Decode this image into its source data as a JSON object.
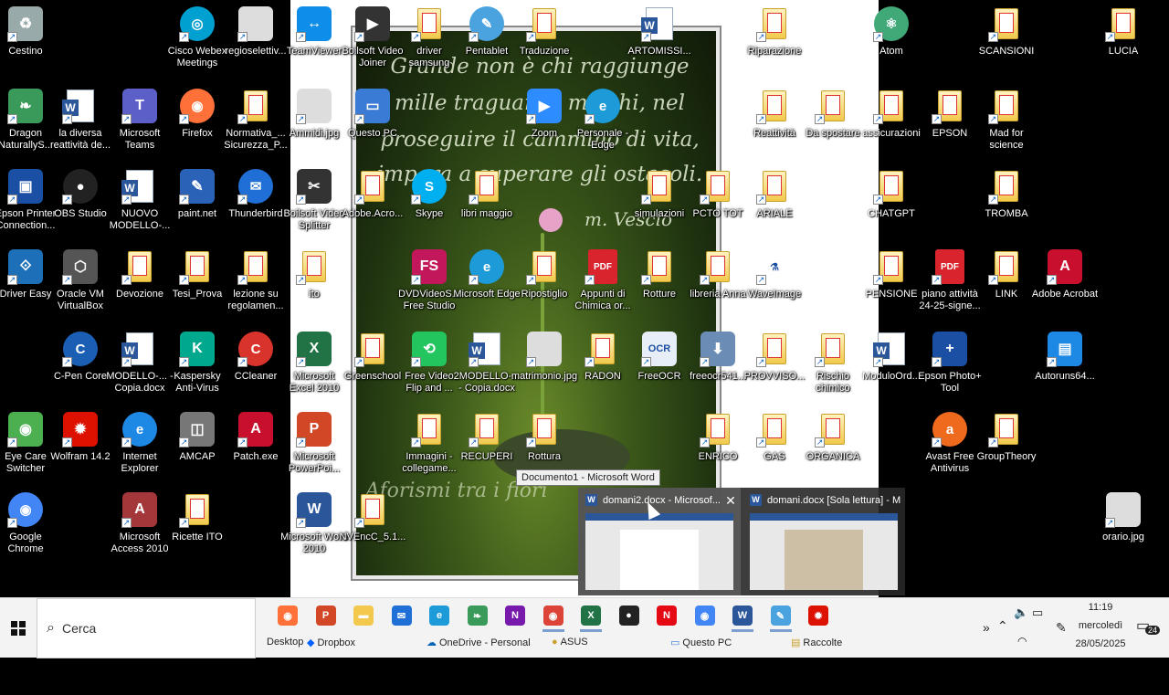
{
  "wallpaper": {
    "poem_lines": [
      "Grande non è chi raggiunge",
      "mille traguardi, ma chi, nel",
      "proseguire il cammino di vita,",
      "impara a superare gli ostacoli."
    ],
    "signature": "m. Vescio",
    "bottom_text": "Aforismi tra i fiori"
  },
  "icons": [
    {
      "label": "Cestino",
      "icon": "recycle-bin-icon"
    },
    {
      "label": "Cisco Webex Meetings",
      "icon": "webex-icon"
    },
    {
      "label": "regioselettiv...",
      "icon": "image-icon"
    },
    {
      "label": "TeamViewer",
      "icon": "teamviewer-icon"
    },
    {
      "label": "Boilsoft Video Joiner",
      "icon": "video-joiner-icon"
    },
    {
      "label": "driver samsung",
      "icon": "folder-icon"
    },
    {
      "label": "Pentablet",
      "icon": "pentablet-icon"
    },
    {
      "label": "Traduzione",
      "icon": "folder-icon"
    },
    {
      "label": "ARTOMISSI...",
      "icon": "word-doc-icon"
    },
    {
      "label": "Riparazione",
      "icon": "folder-icon"
    },
    {
      "label": "Atom",
      "icon": "atom-icon"
    },
    {
      "label": "SCANSIONI",
      "icon": "folder-icon"
    },
    {
      "label": "LUCIA",
      "icon": "folder-icon"
    },
    {
      "label": "Dragon NaturallyS...",
      "icon": "dragon-icon"
    },
    {
      "label": "la diversa reattività de...",
      "icon": "word-doc-icon"
    },
    {
      "label": "Microsoft Teams",
      "icon": "teams-icon"
    },
    {
      "label": "Firefox",
      "icon": "firefox-icon"
    },
    {
      "label": "Normativa_... Sicurezza_P...",
      "icon": "folder-icon"
    },
    {
      "label": "Ammidi.jpg",
      "icon": "image-icon"
    },
    {
      "label": "Questo PC",
      "icon": "computer-icon"
    },
    {
      "label": "Zoom",
      "icon": "zoom-icon"
    },
    {
      "label": "Personale - Edge",
      "icon": "edge-icon"
    },
    {
      "label": "Reattività",
      "icon": "folder-icon"
    },
    {
      "label": "Da spostare",
      "icon": "folder-icon"
    },
    {
      "label": "assicurazioni",
      "icon": "folder-icon"
    },
    {
      "label": "EPSON",
      "icon": "folder-icon"
    },
    {
      "label": "Mad for science",
      "icon": "folder-icon"
    },
    {
      "label": "Epson Printer Connection...",
      "icon": "epson-icon"
    },
    {
      "label": "OBS Studio",
      "icon": "obs-icon"
    },
    {
      "label": "NUOVO MODELLO-...",
      "icon": "word-doc-icon"
    },
    {
      "label": "paint.net",
      "icon": "paintnet-icon"
    },
    {
      "label": "Thunderbird",
      "icon": "thunderbird-icon"
    },
    {
      "label": "Boilsoft Video Splitter",
      "icon": "video-splitter-icon"
    },
    {
      "label": "Adobe.Acro...",
      "icon": "folder-icon"
    },
    {
      "label": "Skype",
      "icon": "skype-icon"
    },
    {
      "label": "libri maggio",
      "icon": "folder-icon"
    },
    {
      "label": "simulazioni",
      "icon": "folder-icon"
    },
    {
      "label": "PCTO TOT",
      "icon": "folder-icon"
    },
    {
      "label": "ARIALE",
      "icon": "folder-icon"
    },
    {
      "label": "CHATGPT",
      "icon": "folder-icon"
    },
    {
      "label": "TROMBA",
      "icon": "folder-icon"
    },
    {
      "label": "Driver Easy",
      "icon": "drivereasy-icon"
    },
    {
      "label": "Oracle VM VirtualBox",
      "icon": "virtualbox-icon"
    },
    {
      "label": "Devozione",
      "icon": "folder-icon"
    },
    {
      "label": "Tesi_Prova",
      "icon": "folder-icon"
    },
    {
      "label": "lezione su regolamen...",
      "icon": "folder-icon"
    },
    {
      "label": "ito",
      "icon": "folder-icon"
    },
    {
      "label": "DVDVideoS... Free Studio",
      "icon": "dvdvideosoft-icon"
    },
    {
      "label": "Microsoft Edge",
      "icon": "edge-icon"
    },
    {
      "label": "Ripostiglio",
      "icon": "folder-icon"
    },
    {
      "label": "Appunti di Chimica or...",
      "icon": "pdf-icon"
    },
    {
      "label": "Rotture",
      "icon": "folder-icon"
    },
    {
      "label": "libreria Anna",
      "icon": "folder-icon"
    },
    {
      "label": "WaveImage",
      "icon": "waveimage-icon"
    },
    {
      "label": "PENSIONE",
      "icon": "folder-icon"
    },
    {
      "label": "piano attività 24-25-signe...",
      "icon": "pdf-icon"
    },
    {
      "label": "LINK",
      "icon": "folder-icon"
    },
    {
      "label": "Adobe Acrobat",
      "icon": "acrobat-icon"
    },
    {
      "label": "C-Pen Core",
      "icon": "cpen-icon"
    },
    {
      "label": "MODELLO-... - Copia.docx",
      "icon": "word-doc-icon"
    },
    {
      "label": "Kaspersky Anti-Virus",
      "icon": "kaspersky-icon"
    },
    {
      "label": "CCleaner",
      "icon": "ccleaner-icon"
    },
    {
      "label": "Microsoft Excel 2010",
      "icon": "excel-icon"
    },
    {
      "label": "Greenschool",
      "icon": "folder-icon"
    },
    {
      "label": "Free Video Flip and ...",
      "icon": "videoflip-icon"
    },
    {
      "label": "2MODELLO-... - Copia.docx",
      "icon": "word-doc-icon"
    },
    {
      "label": "matrimonio.jpg",
      "icon": "image-icon"
    },
    {
      "label": "RADON",
      "icon": "folder-icon"
    },
    {
      "label": "FreeOCR",
      "icon": "freeocr-icon"
    },
    {
      "label": "freeocr541...",
      "icon": "installer-icon"
    },
    {
      "label": "PROVVISO...",
      "icon": "folder-icon"
    },
    {
      "label": "Rischio chimico",
      "icon": "folder-icon"
    },
    {
      "label": "ModuloOrd...",
      "icon": "word-doc-icon"
    },
    {
      "label": "Epson Photo+ Tool",
      "icon": "epson-photo-icon"
    },
    {
      "label": "Autoruns64...",
      "icon": "autoruns-icon"
    },
    {
      "label": "Eye Care Switcher",
      "icon": "eyecare-icon"
    },
    {
      "label": "Wolfram 14.2",
      "icon": "wolfram-icon"
    },
    {
      "label": "Internet Explorer",
      "icon": "ie-icon"
    },
    {
      "label": "AMCAP",
      "icon": "amcap-icon"
    },
    {
      "label": "Patch.exe",
      "icon": "patch-icon"
    },
    {
      "label": "Microsoft PowerPoi...",
      "icon": "powerpoint-icon"
    },
    {
      "label": "Immagini - collegame...",
      "icon": "folder-icon"
    },
    {
      "label": "RECUPERI",
      "icon": "folder-icon"
    },
    {
      "label": "Rottura",
      "icon": "folder-icon"
    },
    {
      "label": "ENRICO",
      "icon": "folder-icon"
    },
    {
      "label": "GAS",
      "icon": "folder-icon"
    },
    {
      "label": "ORGANICA",
      "icon": "folder-icon"
    },
    {
      "label": "Avast Free Antivirus",
      "icon": "avast-icon"
    },
    {
      "label": "GroupTheory",
      "icon": "folder-icon"
    },
    {
      "label": "Google Chrome",
      "icon": "chrome-icon"
    },
    {
      "label": "Microsoft Access 2010",
      "icon": "access-icon"
    },
    {
      "label": "Ricette ITO",
      "icon": "folder-icon"
    },
    {
      "label": "Microsoft Word 2010",
      "icon": "word-icon"
    },
    {
      "label": "NVEncC_5.1...",
      "icon": "folder-icon"
    },
    {
      "label": "orario.jpg",
      "icon": "image-icon"
    }
  ],
  "tooltip": "Documento1 - Microsoft Word",
  "previews": [
    {
      "title": "domani2.docx - Microsof...",
      "icon": "word-icon"
    },
    {
      "title": "domani.docx [Sola lettura] - Mi...",
      "icon": "word-icon"
    }
  ],
  "taskbar": {
    "search_placeholder": "Cerca",
    "apps": [
      "firefox-icon",
      "powerpoint-icon",
      "file-explorer-icon",
      "thunderbird-icon",
      "edge-icon",
      "dragon-icon",
      "onenote-icon",
      "chrome-profile-icon",
      "excel-icon",
      "obs-icon",
      "netflix-icon",
      "chrome-icon",
      "word-icon",
      "pentablet-icon",
      "wolfram-icon"
    ],
    "toolbar_links": [
      {
        "label": "Desktop",
        "icon": "desktop-icon"
      },
      {
        "label": "Dropbox",
        "icon": "dropbox-icon"
      },
      {
        "label": "OneDrive - Personal",
        "icon": "onedrive-icon"
      },
      {
        "label": "ASUS",
        "icon": "user-icon"
      },
      {
        "label": "Questo PC",
        "icon": "computer-icon"
      },
      {
        "label": "Raccolte",
        "icon": "library-icon"
      }
    ],
    "time": "11:19",
    "day": "mercoledì",
    "date": "28/05/2025",
    "notification_count": "24"
  },
  "colors": {
    "accent": "#2b579a",
    "taskbar_bg": "#f3f3f3"
  }
}
